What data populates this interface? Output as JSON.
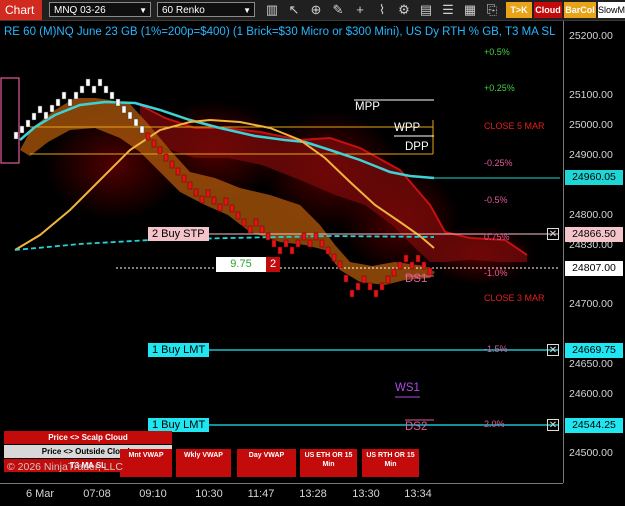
{
  "toolbar": {
    "chart_label": "Chart",
    "instrument": "MNQ 03-26",
    "bar_type": "60 Renko",
    "tk_label": "T>K",
    "cloud_label": "Cloud",
    "barcol_label": "BarCol",
    "slow_label": "SlowM"
  },
  "chart_title": "RE 60 (M)NQ June 23 GB (1%=200p=$400) (1 Brick=$30 Micro or $300 Mini), US Dy RTH % GB, T3 MA SL",
  "price_axis": {
    "ticks": [
      "25200.00",
      "25100.00",
      "25000.00",
      "24900.00",
      "24800.00",
      "24700.00",
      "24600.00",
      "24500.00"
    ],
    "current_price": "24807.00",
    "boxes": [
      {
        "label": "24960.05",
        "color": "#1fd6d6"
      },
      {
        "label": "24866.50",
        "color": "#f4c4cb"
      },
      {
        "label": "24807.00",
        "color": "#ffffff"
      },
      {
        "label": "24669.75",
        "color": "#1fe6f0"
      },
      {
        "label": "24544.25",
        "color": "#1fe6f0"
      }
    ]
  },
  "time_axis": [
    "6 Mar",
    "07:08",
    "09:10",
    "10:30",
    "11:47",
    "13:28",
    "13:30",
    "13:34"
  ],
  "right_labels": {
    "pct_plus_05": "+0.5%",
    "pct_plus_025": "+0.25%",
    "close_5_mar": "CLOSE 5 MAR",
    "pct_minus_025": "-0.25%",
    "pct_minus_05": "-0.5%",
    "pct_minus_075": "0.75%",
    "pct_minus_1": "-1.0%",
    "close_3_mar": "CLOSE 3 MAR",
    "pct_minus_15": "-1.5%",
    "pct_minus_2": "2.0%"
  },
  "pivots": {
    "mpp": "MPP",
    "wpp": "WPP",
    "dpp": "DPP",
    "ds1": "DS1",
    "ws1": "WS1",
    "ds2": "DS2"
  },
  "orders": {
    "stop_label": "2 Buy STP",
    "lmt1_label": "1 Buy LMT",
    "lmt2_label": "1 Buy LMT",
    "position_pnl": "9.75",
    "position_qty": "2"
  },
  "cloud_buttons": {
    "scalp": "Price <> Scalp Cloud",
    "outside": "Price <> Outside Clouds",
    "t3": "T3 MA SL"
  },
  "vwap_buttons": {
    "mnt": "Mnt VWAP",
    "wkly": "Wkly VWAP",
    "day": "Day VWAP",
    "us_eth": "US ETH OR 15 Min",
    "us_rth": "US RTH OR 15 Min"
  },
  "copyright": "© 2026 NinjaTrader, LLC",
  "colors": {
    "accent_red": "#d12b1f",
    "cyan": "#1fe6f0",
    "gold": "#e8a317",
    "pink": "#f4c4cb"
  }
}
